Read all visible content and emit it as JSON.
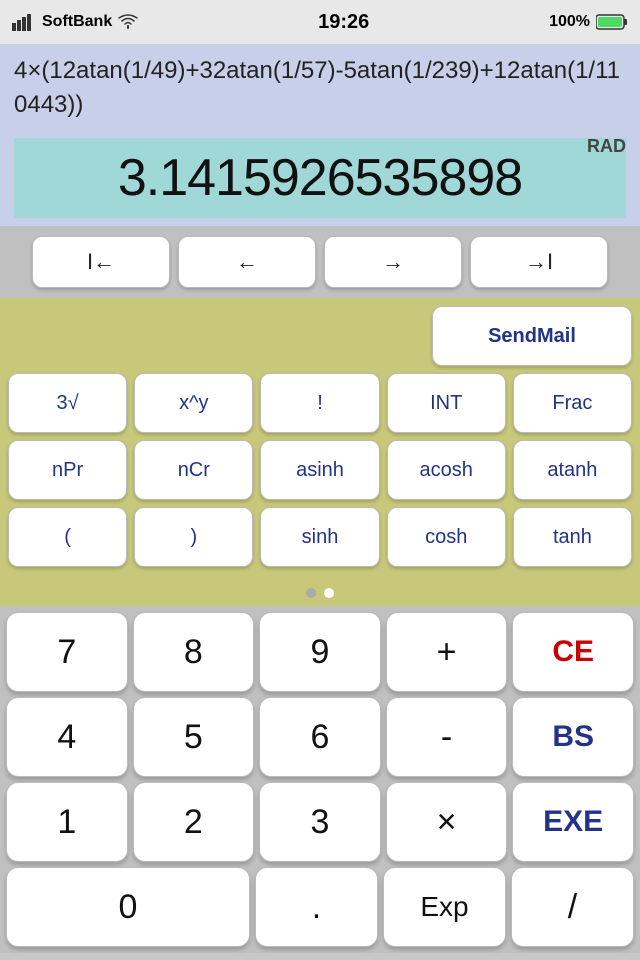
{
  "statusBar": {
    "carrier": "SoftBank",
    "time": "19:26",
    "battery": "100%"
  },
  "expression": "4×(12atan(1/49)+32atan(1/57)-5atan(1/239)+12atan(1/110443))",
  "mode": "RAD",
  "result": "3.1415926535898",
  "navButtons": [
    {
      "label": "I←",
      "name": "nav-home"
    },
    {
      "label": "←",
      "name": "nav-left"
    },
    {
      "label": "→",
      "name": "nav-right"
    },
    {
      "label": "→I",
      "name": "nav-end"
    }
  ],
  "sendMailLabel": "SendMail",
  "sciRows": [
    [
      {
        "label": "3√",
        "name": "cube-root"
      },
      {
        "label": "x^y",
        "name": "power"
      },
      {
        "label": "!",
        "name": "factorial"
      },
      {
        "label": "INT",
        "name": "int"
      },
      {
        "label": "Frac",
        "name": "frac"
      }
    ],
    [
      {
        "label": "nPr",
        "name": "npm"
      },
      {
        "label": "nCr",
        "name": "ncr"
      },
      {
        "label": "asinh",
        "name": "asinh"
      },
      {
        "label": "acosh",
        "name": "acosh"
      },
      {
        "label": "atanh",
        "name": "atanh"
      }
    ],
    [
      {
        "label": "(",
        "name": "open-paren"
      },
      {
        "label": ")",
        "name": "close-paren"
      },
      {
        "label": "sinh",
        "name": "sinh"
      },
      {
        "label": "cosh",
        "name": "cosh"
      },
      {
        "label": "tanh",
        "name": "tanh"
      }
    ]
  ],
  "pageDots": [
    false,
    true
  ],
  "keyRows": [
    [
      {
        "label": "7",
        "name": "key-7",
        "type": "num"
      },
      {
        "label": "8",
        "name": "key-8",
        "type": "num"
      },
      {
        "label": "9",
        "name": "key-9",
        "type": "num"
      },
      {
        "label": "+",
        "name": "key-plus",
        "type": "operator"
      },
      {
        "label": "CE",
        "name": "key-ce",
        "type": "ce"
      }
    ],
    [
      {
        "label": "4",
        "name": "key-4",
        "type": "num"
      },
      {
        "label": "5",
        "name": "key-5",
        "type": "num"
      },
      {
        "label": "6",
        "name": "key-6",
        "type": "num"
      },
      {
        "label": "-",
        "name": "key-minus",
        "type": "operator"
      },
      {
        "label": "BS",
        "name": "key-bs",
        "type": "bs"
      }
    ],
    [
      {
        "label": "1",
        "name": "key-1",
        "type": "num"
      },
      {
        "label": "2",
        "name": "key-2",
        "type": "num"
      },
      {
        "label": "3",
        "name": "key-3",
        "type": "num"
      },
      {
        "label": "×",
        "name": "key-mul",
        "type": "operator"
      },
      {
        "label": "EXE",
        "name": "key-exe",
        "type": "exe"
      }
    ],
    [
      {
        "label": "0",
        "name": "key-0",
        "type": "num",
        "wide": true
      },
      {
        "label": ".",
        "name": "key-dot",
        "type": "num"
      },
      {
        "label": "Exp",
        "name": "key-exp",
        "type": "num"
      },
      {
        "label": "/",
        "name": "key-div",
        "type": "operator"
      }
    ]
  ]
}
